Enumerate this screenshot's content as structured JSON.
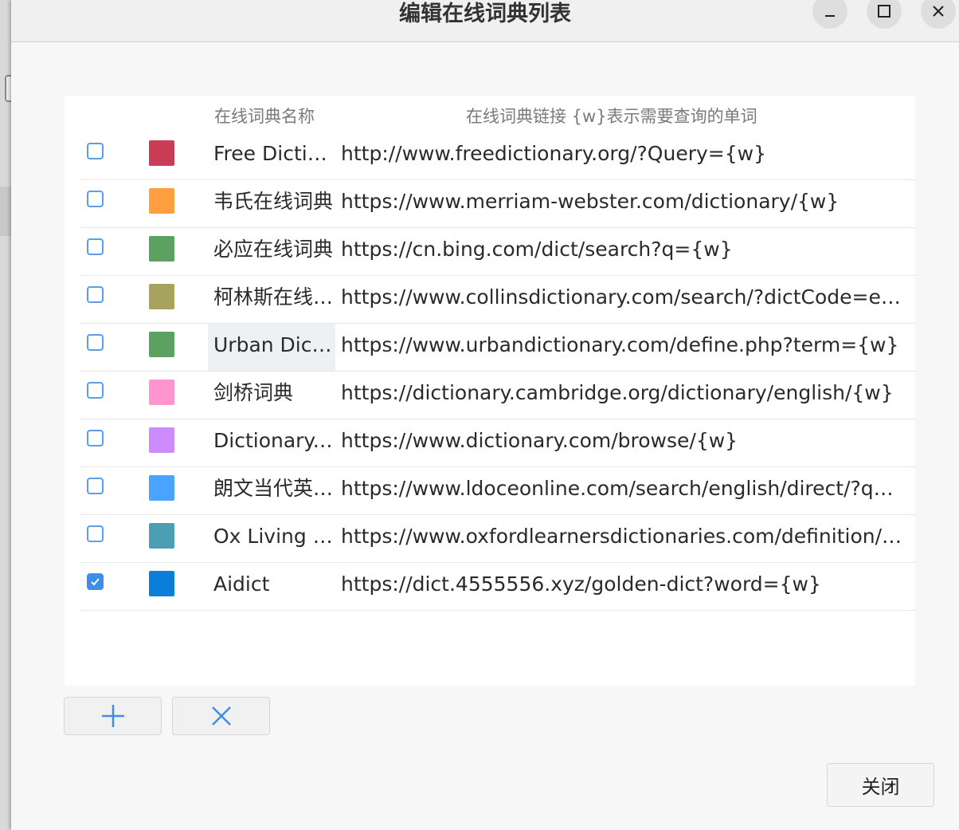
{
  "window": {
    "title": "编辑在线词典列表"
  },
  "table": {
    "headers": {
      "name": "在线词典名称",
      "url": "在线词典链接 {w}表示需要查询的单词"
    },
    "rows": [
      {
        "checked": false,
        "color": "#c93d56",
        "name": "Free Dictionary",
        "url": "http://www.freedictionary.org/?Query={w}"
      },
      {
        "checked": false,
        "color": "#ff9f3f",
        "name": "韦氏在线词典",
        "url": "https://www.merriam-webster.com/dictionary/{w}"
      },
      {
        "checked": false,
        "color": "#5ca160",
        "name": "必应在线词典",
        "url": "https://cn.bing.com/dict/search?q={w}"
      },
      {
        "checked": false,
        "color": "#a7a35e",
        "name": "柯林斯在线词典",
        "url": "https://www.collinsdictionary.com/search/?dictCode=english&q={w}"
      },
      {
        "checked": false,
        "color": "#5ca160",
        "name": "Urban Dictionary",
        "url": "https://www.urbandictionary.com/define.php?term={w}"
      },
      {
        "checked": false,
        "color": "#ff95cf",
        "name": "剑桥词典",
        "url": "https://dictionary.cambridge.org/dictionary/english/{w}"
      },
      {
        "checked": false,
        "color": "#cc8cff",
        "name": "Dictionary.com",
        "url": "https://www.dictionary.com/browse/{w}"
      },
      {
        "checked": false,
        "color": "#4aa3ff",
        "name": "朗文当代英语词典",
        "url": "https://www.ldoceonline.com/search/english/direct/?q={w}"
      },
      {
        "checked": false,
        "color": "#4c9fb3",
        "name": "Ox Living Dictionaries",
        "url": "https://www.oxfordlearnersdictionaries.com/definition/english/{w}"
      },
      {
        "checked": true,
        "color": "#0a7ed9",
        "name": "Aidict",
        "url": "https://dict.4555556.xyz/golden-dict?word={w}"
      }
    ],
    "selected_row_index": 4
  },
  "buttons": {
    "close_label": "关闭"
  },
  "icons": {
    "add": "plus-icon",
    "remove": "x-icon",
    "minimize": "minimize-icon",
    "maximize": "maximize-icon",
    "close": "close-icon"
  },
  "colors": {
    "accent": "#3d8ee6"
  }
}
